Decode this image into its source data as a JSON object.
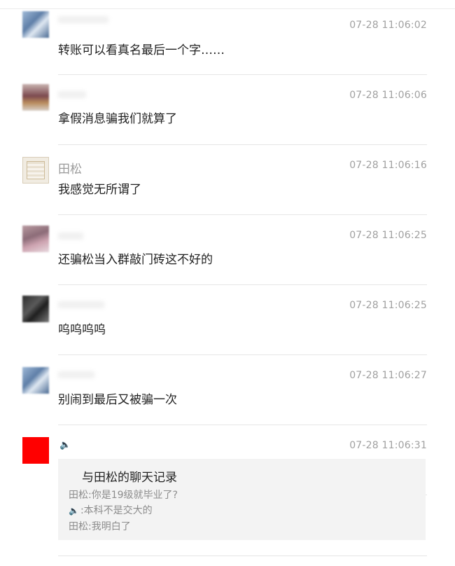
{
  "messages": [
    {
      "name": "",
      "time": "07-28 11:06:02",
      "text": "转账可以看真名最后一个字……",
      "avatar": "blue-blur-avatar"
    },
    {
      "name": "",
      "time": "07-28 11:06:06",
      "text": "拿假消息骗我们就算了",
      "avatar": "photo-blur-avatar"
    },
    {
      "name": "田松",
      "time": "07-28 11:06:16",
      "text": "我感觉无所谓了",
      "avatar": "certificate-avatar"
    },
    {
      "name": "",
      "time": "07-28 11:06:25",
      "text": "还骗松当入群敲门砖这不好的",
      "avatar": "pink-blur-avatar"
    },
    {
      "name": "",
      "time": "07-28 11:06:25",
      "text": "呜呜呜呜",
      "avatar": "dark-blur-avatar"
    },
    {
      "name": "",
      "time": "07-28 11:06:27",
      "text": "别闹到最后又被骗一次",
      "avatar": "blue-blur-avatar"
    },
    {
      "name": "",
      "time": "07-28 11:06:31",
      "text": "",
      "avatar": "red-avatar"
    }
  ],
  "forwarded_record": {
    "title": "与田松的聊天记录",
    "lines": [
      {
        "prefix": "田松:",
        "text": "你是19级就毕业了?"
      },
      {
        "prefix": "",
        "text": ":本科不是交大的"
      },
      {
        "prefix": "田松:",
        "text": "我明白了"
      }
    ]
  },
  "icons": {
    "speaker": "speaker-icon"
  },
  "colors": {
    "red_avatar": "#ff0000"
  }
}
